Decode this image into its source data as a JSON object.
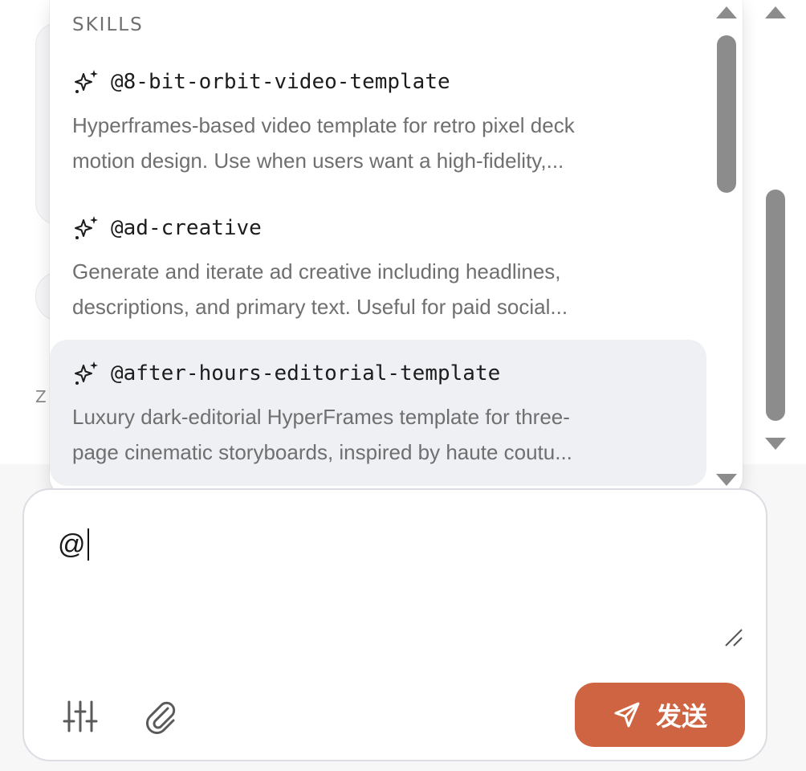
{
  "background": {
    "partial_letter": "Z"
  },
  "popup": {
    "header": "SKILLS",
    "items": [
      {
        "name": "@8-bit-orbit-video-template",
        "desc_line1": "Hyperframes-based video template for retro pixel deck",
        "desc_line2": "motion design. Use when users want a high-fidelity,...",
        "icon": "sparkles-icon"
      },
      {
        "name": "@ad-creative",
        "desc_line1": "Generate and iterate ad creative including headlines,",
        "desc_line2": "descriptions, and primary text. Useful for paid social...",
        "icon": "sparkles-icon"
      },
      {
        "name": "@after-hours-editorial-template",
        "desc_line1": "Luxury dark-editorial HyperFrames template for three-",
        "desc_line2": "page cinematic storyboards, inspired by haute coutu...",
        "icon": "sparkles-icon",
        "selected": true
      }
    ]
  },
  "composer": {
    "value": "@",
    "tools": [
      "sliders-icon",
      "paperclip-icon"
    ],
    "send_label": "发送",
    "send_icon": "send-icon"
  },
  "colors": {
    "accent": "#cf6442",
    "selected_bg": "#eef0f3",
    "scrollbar": "#8c8c8c"
  }
}
